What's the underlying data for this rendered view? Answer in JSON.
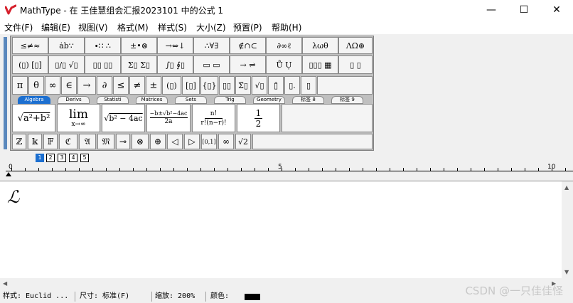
{
  "window": {
    "title": "MathType - 在 王佳慧组会汇报2023101 中的公式 1",
    "minimize_glyph": "—",
    "maximize_glyph": "☐",
    "close_glyph": "✕"
  },
  "menu": [
    "文件(F)",
    "编辑(E)",
    "视图(V)",
    "格式(M)",
    "样式(S)",
    "大小(Z)",
    "预置(P)",
    "帮助(H)"
  ],
  "toolbar": {
    "row1": [
      "≤≠≈",
      "ȧb∵",
      "∙∷ ∴",
      "±•⊗",
      "→⇔↓",
      "∴∀∃",
      "∉∩⊂",
      "∂∞ℓ",
      "λωθ",
      "ΛΩ⊛"
    ],
    "row2": [
      "(▯) [▯]",
      "▯/▯ √▯",
      "▯▯ ▯▯",
      "Σ▯ Σ▯",
      "∫▯ ∮▯",
      "▭ ▭",
      "→ ⇌",
      "Ů Ụ",
      "▯▯▯ ▦",
      "▯ ▯"
    ],
    "row3": [
      "π",
      "θ",
      "∞",
      "∈",
      "→",
      "∂",
      "≤",
      "≠",
      "±",
      "(▯)",
      "[▯]",
      "{▯}",
      "▯▯",
      "Σ̈▯",
      "√▯",
      "▯̄",
      "▯.",
      "▯"
    ],
    "tabs": [
      {
        "label": "Algebra",
        "active": true
      },
      {
        "label": "Derivs",
        "active": false
      },
      {
        "label": "Statisti",
        "active": false
      },
      {
        "label": "Matrices",
        "active": false
      },
      {
        "label": "Sets",
        "active": false
      },
      {
        "label": "Trig",
        "active": false
      },
      {
        "label": "Geometry",
        "active": false
      },
      {
        "label": "标签 8",
        "active": false
      },
      {
        "label": "标签 9",
        "active": false
      }
    ],
    "templates": [
      "√(a²+b²)",
      "lim x→∞",
      "√(b²−4ac)",
      "−b±√(b²−4ac) / 2a",
      "n! / r!(n−r)!",
      "1/2"
    ],
    "symbols": [
      "ℤ",
      "𝕜",
      "𝔽",
      "ℭ",
      "𝔄",
      "𝔐",
      "⊸",
      "⊗",
      "⊕",
      "◁",
      "▷",
      "[0,1]",
      "∞",
      "√2"
    ],
    "small_tabs": [
      {
        "label": "1",
        "active": true
      },
      {
        "label": "2",
        "active": false
      },
      {
        "label": "3",
        "active": false
      },
      {
        "label": "4",
        "active": false
      },
      {
        "label": "5",
        "active": false
      }
    ]
  },
  "ruler": {
    "labels": [
      "0",
      "5",
      "10"
    ]
  },
  "editor": {
    "content": "ℒ"
  },
  "status": {
    "style": "样式: Euclid ...",
    "size": "尺寸: 标准(F)",
    "zoom": "缩放: 200%",
    "color_label": "颜色:",
    "color_value": "#000000"
  },
  "watermark": "CSDN @一只佳佳怪"
}
